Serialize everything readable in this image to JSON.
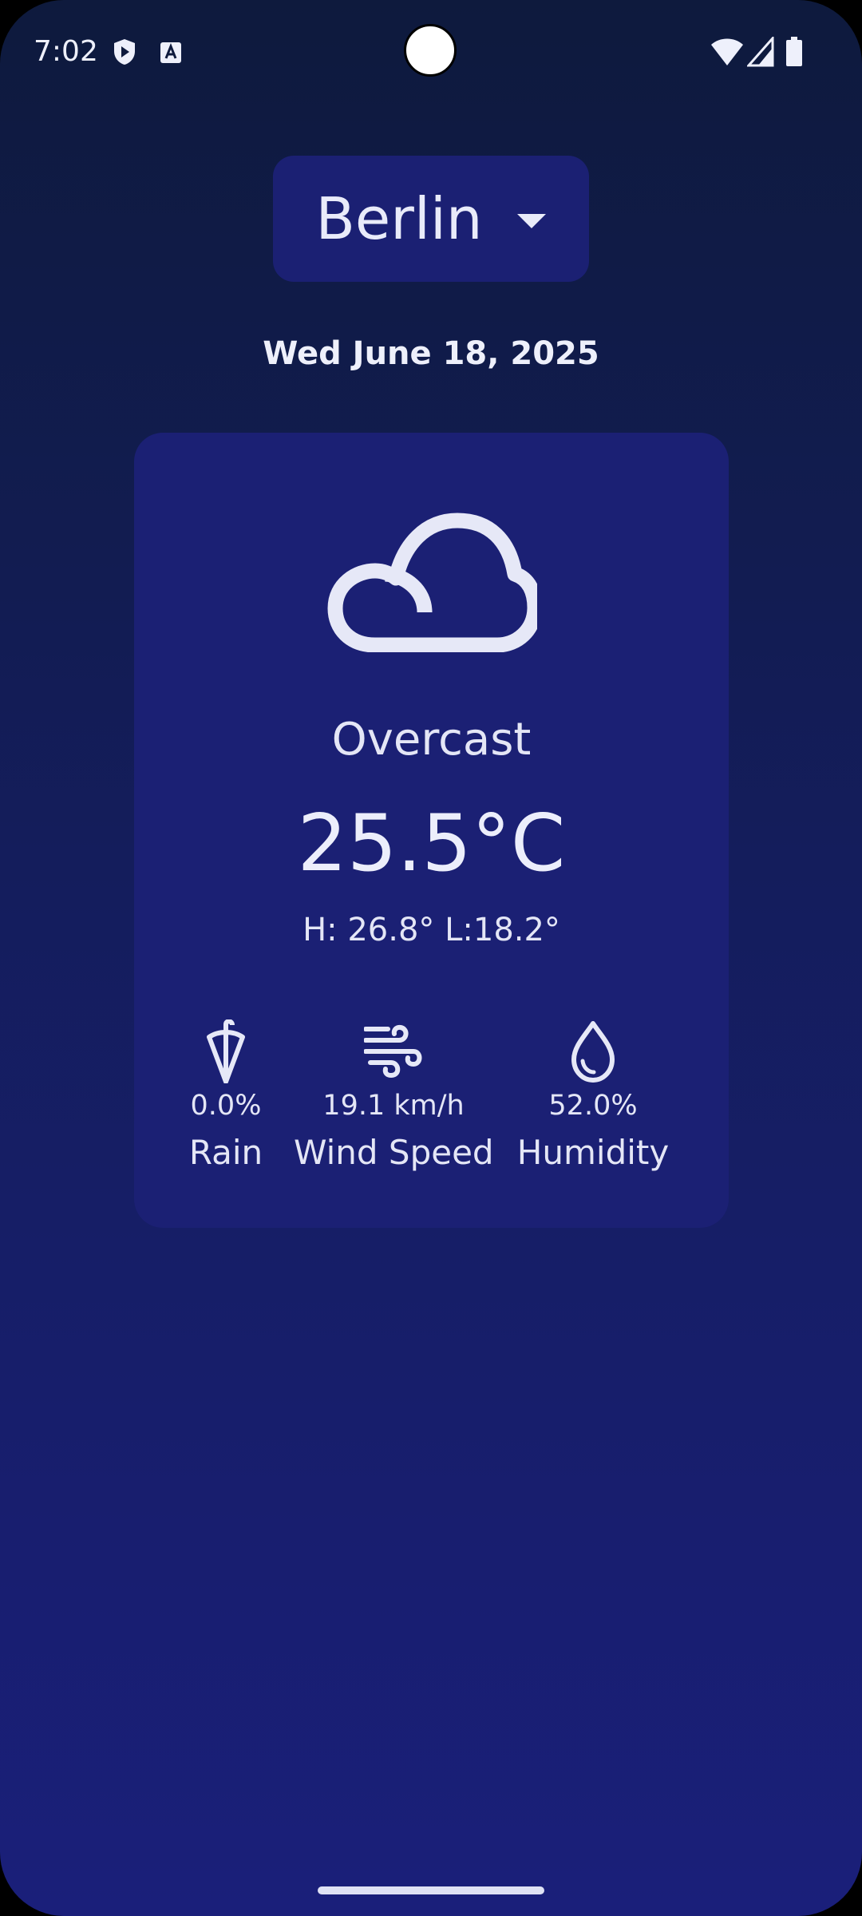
{
  "status_bar": {
    "time": "7:02",
    "icons": [
      "play-protect-icon",
      "keyboard-a-icon",
      "wifi-icon",
      "signal-icon",
      "battery-icon"
    ]
  },
  "city_selector": {
    "selected": "Berlin"
  },
  "date": "Wed June 18, 2025",
  "weather": {
    "icon": "cloud-icon",
    "condition": "Overcast",
    "temperature": "25.5°C",
    "high_low": "H: 26.8° L:18.2°"
  },
  "metrics": [
    {
      "icon": "umbrella-icon",
      "value": "0.0%",
      "label": "Rain"
    },
    {
      "icon": "wind-icon",
      "value": "19.1 km/h",
      "label": "Wind Speed"
    },
    {
      "icon": "drop-icon",
      "value": "52.0%",
      "label": "Humidity"
    }
  ],
  "colors": {
    "background_top": "#0e1a3d",
    "background_bottom": "#1a1f7a",
    "card": "#1b2074",
    "text": "#e6e8f7"
  }
}
